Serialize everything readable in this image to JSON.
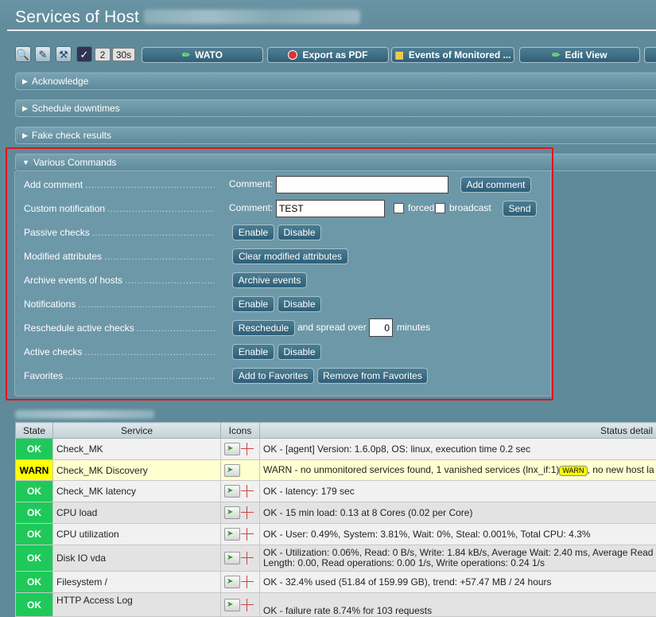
{
  "title": "Services of Host",
  "toolbar": {
    "num_columns": "2",
    "refresh": "30s",
    "wato": "WATO",
    "export_pdf": "Export as PDF",
    "events": "Events of Monitored ...",
    "edit_view": "Edit View"
  },
  "folds": {
    "acknowledge": "Acknowledge",
    "downtimes": "Schedule downtimes",
    "fake": "Fake check results",
    "various": "Various Commands"
  },
  "commands": {
    "add_comment": {
      "label": "Add comment",
      "comment_label": "Comment:",
      "value": "",
      "button": "Add comment"
    },
    "custom_notification": {
      "label": "Custom notification",
      "comment_label": "Comment:",
      "value": "TEST",
      "forced": "forced",
      "broadcast": "broadcast",
      "button": "Send"
    },
    "passive": {
      "label": "Passive checks",
      "enable": "Enable",
      "disable": "Disable"
    },
    "modified": {
      "label": "Modified attributes",
      "button": "Clear modified attributes"
    },
    "archive": {
      "label": "Archive events of hosts",
      "button": "Archive events"
    },
    "notifications": {
      "label": "Notifications",
      "enable": "Enable",
      "disable": "Disable"
    },
    "reschedule": {
      "label": "Reschedule active checks",
      "button": "Reschedule",
      "spread": "and spread over",
      "value": "0",
      "unit": "minutes"
    },
    "active": {
      "label": "Active checks",
      "enable": "Enable",
      "disable": "Disable"
    },
    "favorites": {
      "label": "Favorites",
      "add": "Add to Favorites",
      "remove": "Remove from Favorites"
    }
  },
  "table": {
    "headers": [
      "State",
      "Service",
      "Icons",
      "Status detail"
    ],
    "rows": [
      {
        "state": "OK",
        "service": "Check_MK",
        "detail": "OK - [agent] Version: 1.6.0p8, OS: linux, execution time 0.2 sec"
      },
      {
        "state": "WARN",
        "service": "Check_MK Discovery",
        "detail": "WARN - no unmonitored services found, 1 vanished services (lnx_if:1)",
        "badge": "WARN",
        "detail_after": ", no new host la"
      },
      {
        "state": "OK",
        "service": "Check_MK latency",
        "detail": "OK - latency: 179 sec"
      },
      {
        "state": "OK",
        "service": "CPU load",
        "detail": "OK - 15 min load: 0.13 at 8 Cores (0.02 per Core)"
      },
      {
        "state": "OK",
        "service": "CPU utilization",
        "detail": "OK - User: 0.49%, System: 3.81%, Wait: 0%, Steal: 0.001%, Total CPU: 4.3%"
      },
      {
        "state": "OK",
        "service": "Disk IO vda",
        "detail": "OK - Utilization: 0.06%, Read: 0 B/s, Write: 1.84 kB/s, Average Wait: 2.40 ms, Average Read",
        "detail2": "Length: 0.00, Read operations: 0.00 1/s, Write operations: 0.24 1/s"
      },
      {
        "state": "OK",
        "service": "Filesystem /",
        "detail": "OK - 32.4% used (51.84 of 159.99 GB), trend: +57.47 MB / 24 hours"
      },
      {
        "state": "OK",
        "service": "HTTP Access Log",
        "detail": "OK - failure rate 8.74% for 103 requests"
      }
    ]
  },
  "colors": {
    "ok": "#1ec95a",
    "warn": "#ffff00",
    "frame": "#e0141e",
    "background": "#5f8a9a"
  }
}
